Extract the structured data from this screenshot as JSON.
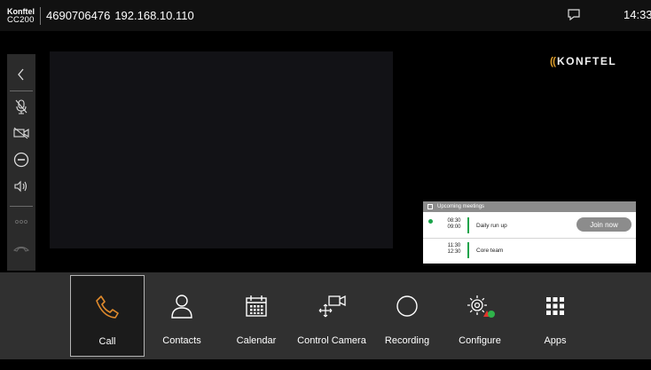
{
  "header": {
    "brand_line1": "Konftel",
    "brand_line2": "CC200",
    "phone": "4690706476",
    "ip": "192.168.10.110",
    "time": "14:33",
    "chat_icon": "chat-bubble-icon"
  },
  "logo": {
    "text": "KONFTEL"
  },
  "sidebar": {
    "icons": [
      "back-icon",
      "mic-muted-icon",
      "camera-off-icon",
      "volume-minus-icon",
      "volume-icon",
      "more-icon",
      "hang-up-icon"
    ]
  },
  "meetings": {
    "title": "Upcoming meetings",
    "items": [
      {
        "start": "08:30",
        "end": "09:00",
        "name": "Daily run up",
        "action": "Join now",
        "live": true
      },
      {
        "start": "11:30",
        "end": "12:30",
        "name": "Core team"
      }
    ]
  },
  "nav": [
    {
      "label": "Call",
      "icon": "phone-icon",
      "selected": true
    },
    {
      "label": "Contacts",
      "icon": "person-icon"
    },
    {
      "label": "Calendar",
      "icon": "calendar-icon"
    },
    {
      "label": "Control Camera",
      "icon": "camera-control-icon"
    },
    {
      "label": "Recording",
      "icon": "record-icon"
    },
    {
      "label": "Configure",
      "icon": "gear-icon"
    },
    {
      "label": "Apps",
      "icon": "grid-icon"
    }
  ],
  "colors": {
    "accent": "#e08a2c",
    "green": "#1aa34a",
    "panel": "#303030",
    "sidebar": "#2b2b2b"
  }
}
